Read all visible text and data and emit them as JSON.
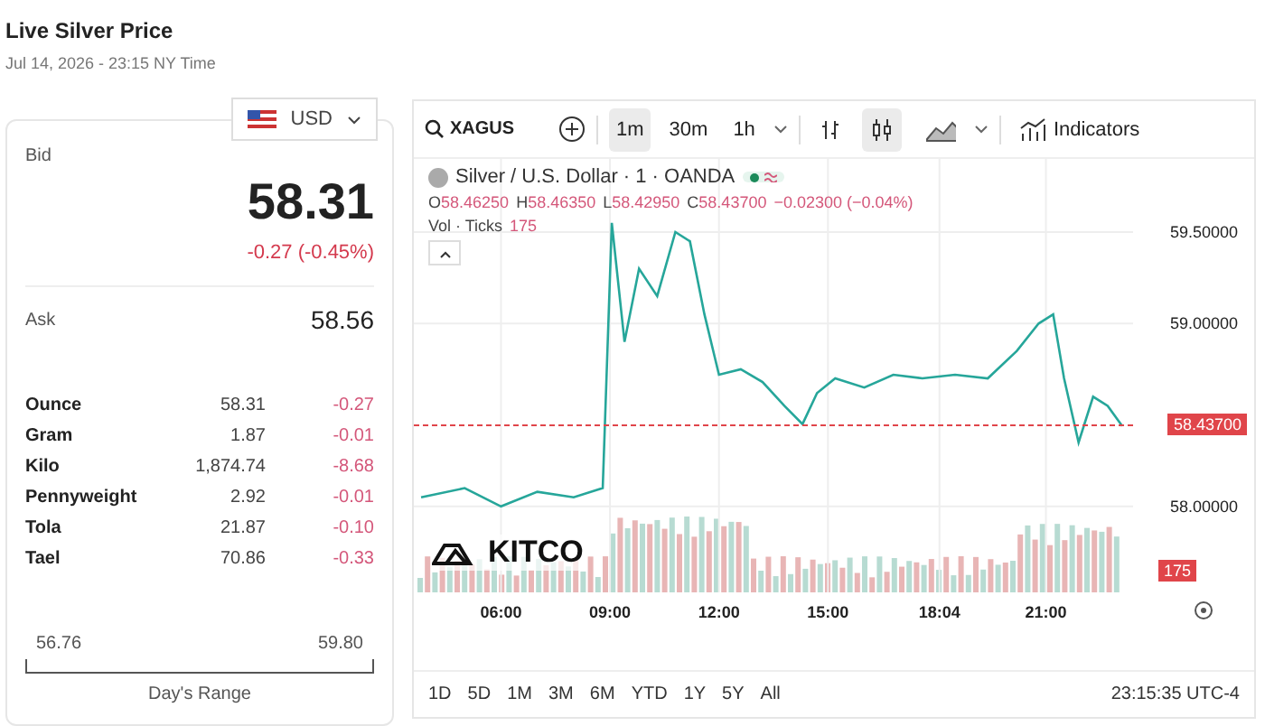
{
  "header": {
    "title": "Live Silver Price",
    "timestamp": "Jul 14, 2026 - 23:15 NY Time"
  },
  "currency": {
    "label": "USD"
  },
  "bid": {
    "label": "Bid",
    "price": "58.31",
    "change": "-0.27 (-0.45%)"
  },
  "ask": {
    "label": "Ask",
    "price": "58.56"
  },
  "units": [
    {
      "name": "Ounce",
      "price": "58.31",
      "change": "-0.27"
    },
    {
      "name": "Gram",
      "price": "1.87",
      "change": "-0.01"
    },
    {
      "name": "Kilo",
      "price": "1,874.74",
      "change": "-8.68"
    },
    {
      "name": "Pennyweight",
      "price": "2.92",
      "change": "-0.01"
    },
    {
      "name": "Tola",
      "price": "21.87",
      "change": "-0.10"
    },
    {
      "name": "Tael",
      "price": "70.86",
      "change": "-0.33"
    }
  ],
  "range": {
    "low": "56.76",
    "high": "59.80",
    "label": "Day's Range"
  },
  "chart_panel": {
    "symbol": "XAGUS",
    "intervals": [
      {
        "label": "1m",
        "selected": true
      },
      {
        "label": "30m",
        "selected": false
      },
      {
        "label": "1h",
        "selected": false
      }
    ],
    "chart_styles": [
      {
        "kind": "bars",
        "selected": false
      },
      {
        "kind": "candles",
        "selected": true
      },
      {
        "kind": "area",
        "selected": false
      }
    ],
    "indicators": "Indicators",
    "legend": {
      "title": "Silver / U.S. Dollar · 1 · OANDA",
      "ohlc": [
        {
          "key": "O",
          "value": "58.46250"
        },
        {
          "key": "H",
          "value": "58.46350"
        },
        {
          "key": "L",
          "value": "58.42950"
        },
        {
          "key": "C",
          "value": "58.43700"
        }
      ],
      "change": "−0.02300 (−0.04%)",
      "volume_label": "Vol · Ticks",
      "volume_value": "175"
    },
    "logo": "KITCO",
    "price_tag": "58.43700",
    "volume_tag": "175",
    "chart_data": {
      "type": "line",
      "x": [
        3.8,
        5,
        6,
        7,
        8,
        8.8,
        9.05,
        9.4,
        9.8,
        10.3,
        10.8,
        11.2,
        11.6,
        12,
        12.6,
        13.2,
        13.8,
        14.3,
        14.7,
        15.2,
        16,
        16.8,
        17.6,
        18.5,
        19.4,
        20.2,
        20.8,
        21.2,
        21.5,
        21.9,
        22.3,
        22.7,
        23.1
      ],
      "xlim": [
        3.6,
        23.4
      ],
      "grid": true,
      "series": [
        {
          "color": "#26a69a",
          "values": [
            58.05,
            58.1,
            58.0,
            58.08,
            58.05,
            58.1,
            59.55,
            58.9,
            59.3,
            59.15,
            59.5,
            59.45,
            59.05,
            58.72,
            58.75,
            58.68,
            58.55,
            58.45,
            58.62,
            58.7,
            58.65,
            58.72,
            58.7,
            58.72,
            58.7,
            58.85,
            59.0,
            59.05,
            58.7,
            58.35,
            58.6,
            58.55,
            58.44
          ]
        }
      ],
      "ylim": [
        57.53,
        59.9
      ],
      "yticks": [
        {
          "value": 58,
          "label": "58.00000"
        },
        {
          "value": 59,
          "label": "59.00000"
        },
        {
          "value": 59.5,
          "label": "59.50000"
        }
      ],
      "xticks": [
        {
          "value": 6,
          "label": "06:00"
        },
        {
          "value": 9,
          "label": "09:00"
        },
        {
          "value": 12,
          "label": "12:00"
        },
        {
          "value": 15,
          "label": "15:00"
        },
        {
          "value": 18.07,
          "label": "18:04"
        },
        {
          "value": 21,
          "label": "21:00"
        }
      ]
    },
    "ranges": [
      "1D",
      "5D",
      "1M",
      "3M",
      "6M",
      "YTD",
      "1Y",
      "5Y",
      "All"
    ],
    "clock": "23:15:35 UTC-4"
  }
}
